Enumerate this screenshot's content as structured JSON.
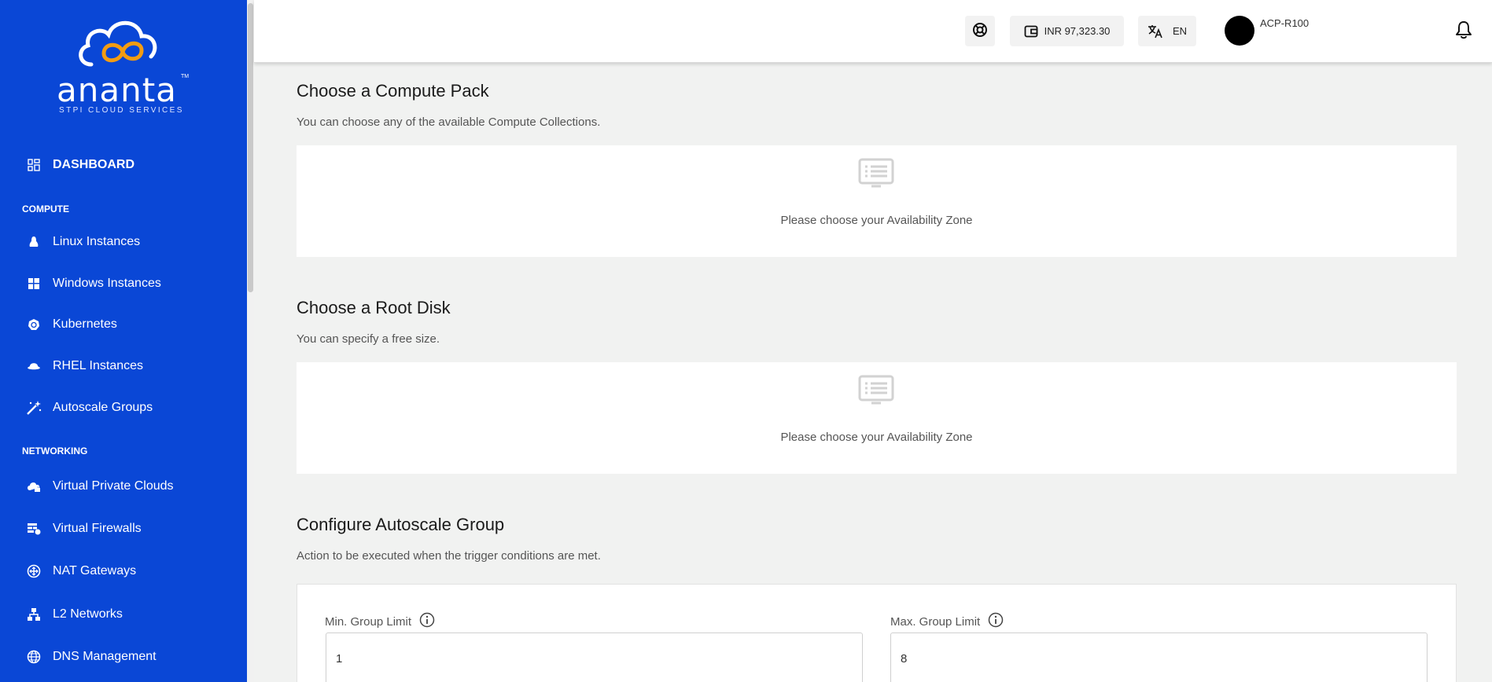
{
  "brand": {
    "name": "ananta",
    "tagline": "STPI CLOUD SERVICES",
    "tm": "TM"
  },
  "sidebar": {
    "dashboard": "DASHBOARD",
    "sections": {
      "compute": "COMPUTE",
      "networking": "NETWORKING"
    },
    "compute_items": [
      {
        "label": "Linux Instances",
        "icon": "linux-icon"
      },
      {
        "label": "Windows Instances",
        "icon": "windows-icon"
      },
      {
        "label": "Kubernetes",
        "icon": "kubernetes-icon"
      },
      {
        "label": "RHEL Instances",
        "icon": "redhat-icon"
      },
      {
        "label": "Autoscale Groups",
        "icon": "magic-wand-icon"
      }
    ],
    "networking_items": [
      {
        "label": "Virtual Private Clouds",
        "icon": "cloud-lock-icon"
      },
      {
        "label": "Virtual Firewalls",
        "icon": "firewall-icon"
      },
      {
        "label": "NAT Gateways",
        "icon": "nat-gateway-icon"
      },
      {
        "label": "L2 Networks",
        "icon": "network-icon"
      },
      {
        "label": "DNS Management",
        "icon": "globe-icon"
      }
    ]
  },
  "header": {
    "balance": "INR 97,323.30",
    "language": "EN",
    "account": "ACP-R100"
  },
  "compute_pack": {
    "title": "Choose a Compute Pack",
    "description": "You can choose any of the available Compute Collections.",
    "empty_message": "Please choose your Availability Zone"
  },
  "root_disk": {
    "title": "Choose a Root Disk",
    "description": "You can specify a free size.",
    "empty_message": "Please choose your Availability Zone"
  },
  "autoscale": {
    "title": "Configure Autoscale Group",
    "description": "Action to be executed when the trigger conditions are met.",
    "min_label": "Min. Group Limit",
    "min_value": "1",
    "max_label": "Max. Group Limit",
    "max_value": "8"
  },
  "colors": {
    "sidebar": "#0a47d6",
    "background": "#f1f2f1",
    "logo_accent": "#f39c12"
  }
}
